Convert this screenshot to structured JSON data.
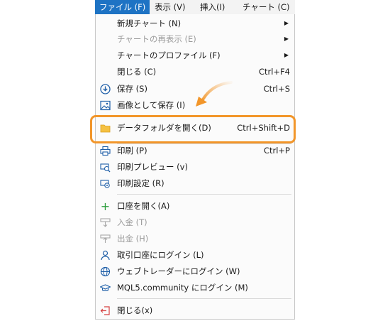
{
  "menubar": {
    "items": [
      {
        "label": "ファイル (F)"
      },
      {
        "label": "表示 (V)"
      },
      {
        "label": "挿入(I)"
      },
      {
        "label": "チャート (C)"
      }
    ]
  },
  "menu": {
    "new_chart": "新規チャート (N)",
    "chart_reshow": "チャートの再表示 (E)",
    "chart_profile": "チャートのプロファイル (F)",
    "close": {
      "label": "閉じる (C)",
      "shortcut": "Ctrl+F4"
    },
    "save": {
      "label": "保存 (S)",
      "shortcut": "Ctrl+S"
    },
    "save_image": "画像として保存 (I)",
    "open_data_folder": {
      "label": "データフォルダを開く(D)",
      "shortcut": "Ctrl+Shift+D"
    },
    "print": {
      "label": "印刷 (P)",
      "shortcut": "Ctrl+P"
    },
    "print_preview": "印刷プレビュー (v)",
    "print_setup": "印刷設定 (R)",
    "open_account": "口座を開く(A)",
    "deposit": "入金 (T)",
    "withdraw": "出金 (H)",
    "login_account": "取引口座にログイン (L)",
    "login_webtrader": "ウェブトレーダーにログイン (W)",
    "login_mql5": "MQL5.community にログイン (M)",
    "exit": "閉じる(x)"
  },
  "colors": {
    "menubar_active": "#1e73c4",
    "highlight": "#f2962a"
  }
}
